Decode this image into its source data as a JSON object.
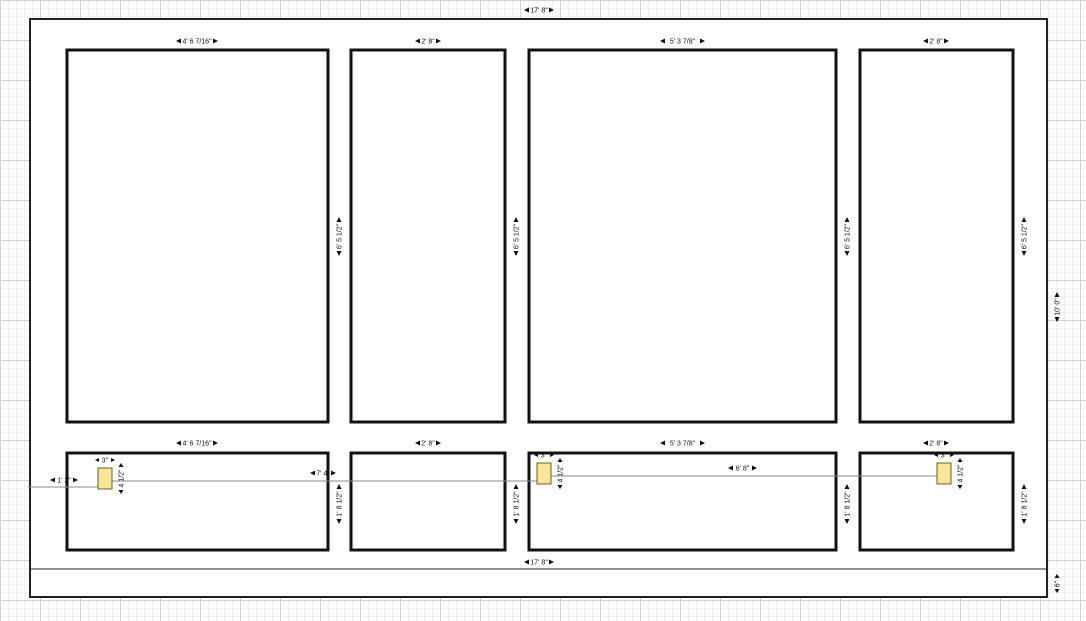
{
  "colors": {
    "panel_stroke": "#111111",
    "outer_stroke": "#222222",
    "outlet_fill": "#f7e59a",
    "outlet_stroke": "#6b5d22",
    "guide_line": "#888888",
    "wall_fill": "#ffffff"
  },
  "wall": {
    "top_width": "17' 8\"",
    "bottom_width": "17' 8\"",
    "height": "10' 0\"",
    "baseboard_height": "6\""
  },
  "upper_panels": [
    {
      "id": "upper-1",
      "width": "4' 6 7/16\"",
      "height": "6' 5 1/2\""
    },
    {
      "id": "upper-2",
      "width": "2' 8\"",
      "height": "6' 5 1/2\""
    },
    {
      "id": "upper-3",
      "width": "5' 3 7/8\"",
      "height": "6' 5 1/2\""
    },
    {
      "id": "upper-4",
      "width": "2' 8\"",
      "height": "6' 5 1/2\""
    }
  ],
  "lower_panels": [
    {
      "id": "lower-1",
      "width": "4' 6 7/16\"",
      "height": "1' 8 1/2\""
    },
    {
      "id": "lower-2",
      "width": "2' 8\"",
      "height": "1' 8 1/2\""
    },
    {
      "id": "lower-3",
      "width": "5' 3 7/8\"",
      "height": "1' 8 1/2\""
    },
    {
      "id": "lower-4",
      "width": "2' 8\"",
      "height": "1' 8 1/2\""
    }
  ],
  "outlets": [
    {
      "id": "outlet-1",
      "width": "3\"",
      "height": "4 1/2\""
    },
    {
      "id": "outlet-2",
      "width": "3\"",
      "height": "4 1/2\""
    },
    {
      "id": "outlet-3",
      "width": "3\"",
      "height": "4 1/2\""
    }
  ],
  "guides": {
    "left_offset": "1' 2\"",
    "outlet2_offset": "7' 4\"",
    "outlet3_offset": "6' 8\""
  }
}
